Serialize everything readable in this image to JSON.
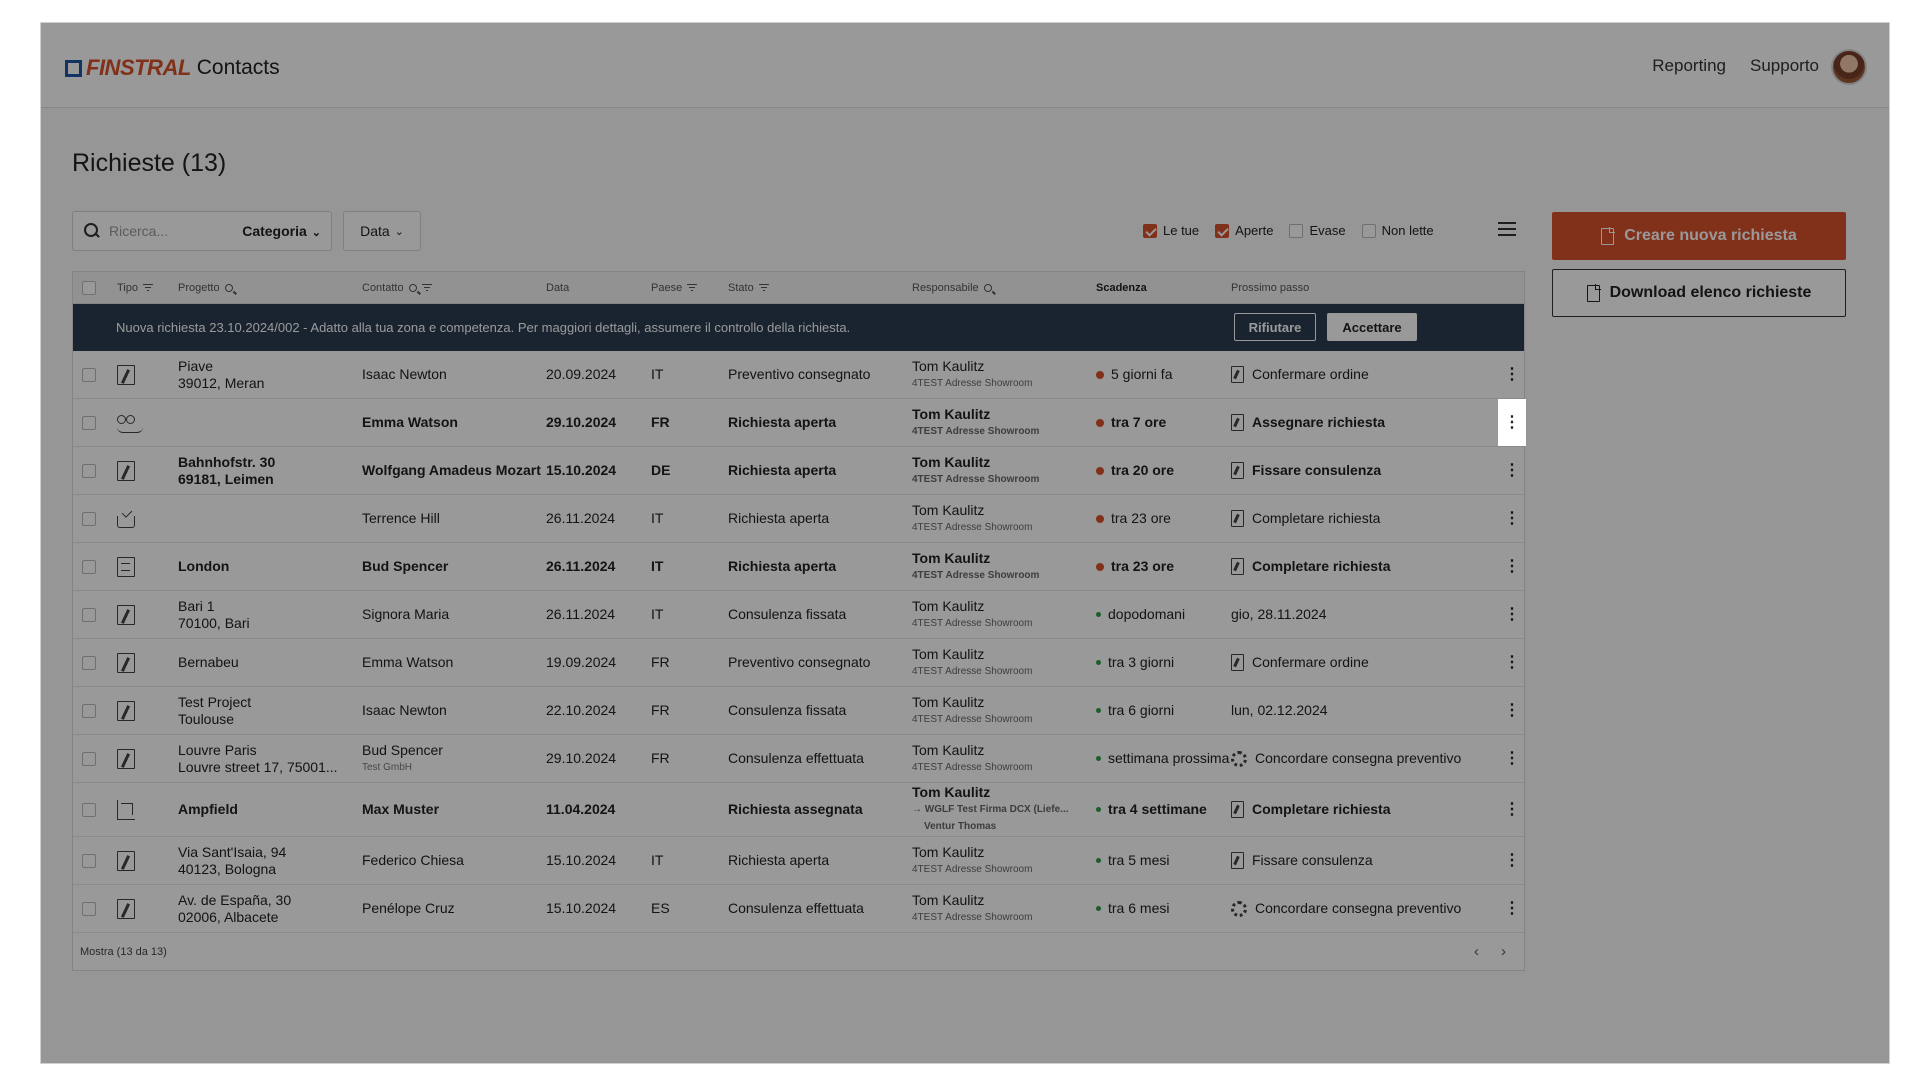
{
  "header": {
    "brand": "FINSTRAL",
    "app_name": "Contacts",
    "nav": [
      "Reporting",
      "Supporto"
    ]
  },
  "page_title": "Richieste (13)",
  "toolbar": {
    "search_placeholder": "Ricerca...",
    "category_label": "Categoria",
    "date_label": "Data",
    "filters": [
      {
        "label": "Le tue",
        "checked": true
      },
      {
        "label": "Aperte",
        "checked": true
      },
      {
        "label": "Evase",
        "checked": false
      },
      {
        "label": "Non lette",
        "checked": false
      }
    ]
  },
  "actions": {
    "create": "Creare nuova richiesta",
    "download": "Download elenco richieste"
  },
  "columns": {
    "tipo": "Tipo",
    "progetto": "Progetto",
    "contatto": "Contatto",
    "data": "Data",
    "paese": "Paese",
    "stato": "Stato",
    "responsabile": "Responsabile",
    "scadenza": "Scadenza",
    "prossimo": "Prossimo passo"
  },
  "banner": {
    "text": "Nuova richiesta 23.10.2024/002 - Adatto alla tua zona e competenza. Per maggiori dettagli, assumere il controllo della richiesta.",
    "reject": "Rifiutare",
    "accept": "Accettare"
  },
  "rows": [
    {
      "type_icon": "project-icon",
      "proj1": "Piave",
      "proj2": "39012, Meran",
      "contact": "Isaac Newton",
      "contact_sub": "",
      "date": "20.09.2024",
      "paese": "IT",
      "stato": "Preventivo consegnato",
      "resp_name": "Tom Kaulitz",
      "resp_sub": "4TEST Adresse Showroom",
      "resp_sub2": "",
      "scad": "5 giorni fa",
      "scad_color": "orange",
      "next_icon": "doc",
      "next": "Confermare ordine",
      "bold": false
    },
    {
      "type_icon": "people-icon",
      "proj1": "",
      "proj2": "",
      "contact": "Emma Watson",
      "contact_sub": "",
      "date": "29.10.2024",
      "paese": "FR",
      "stato": "Richiesta aperta",
      "resp_name": "Tom Kaulitz",
      "resp_sub": "4TEST Adresse Showroom",
      "resp_sub2": "",
      "scad": "tra 7 ore",
      "scad_color": "orange",
      "next_icon": "doc",
      "next": "Assegnare richiesta",
      "bold": true
    },
    {
      "type_icon": "project-icon",
      "proj1": "Bahnhofstr. 30",
      "proj2": "69181, Leimen",
      "contact": "Wolfgang Amadeus Mozart",
      "contact_sub": "",
      "date": "15.10.2024",
      "paese": "DE",
      "stato": "Richiesta aperta",
      "resp_name": "Tom Kaulitz",
      "resp_sub": "4TEST Adresse Showroom",
      "resp_sub2": "",
      "scad": "tra 20 ore",
      "scad_color": "orange",
      "next_icon": "doc",
      "next": "Fissare consulenza",
      "bold": true
    },
    {
      "type_icon": "inbox-icon",
      "proj1": "",
      "proj2": "",
      "contact": "Terrence Hill",
      "contact_sub": "",
      "date": "26.11.2024",
      "paese": "IT",
      "stato": "Richiesta aperta",
      "resp_name": "Tom Kaulitz",
      "resp_sub": "4TEST Adresse Showroom",
      "resp_sub2": "",
      "scad": "tra 23 ore",
      "scad_color": "orange",
      "next_icon": "doc",
      "next": "Completare richiesta",
      "bold": false
    },
    {
      "type_icon": "catalog-icon",
      "proj1": "London",
      "proj2": "",
      "contact": "Bud Spencer",
      "contact_sub": "",
      "date": "26.11.2024",
      "paese": "IT",
      "stato": "Richiesta aperta",
      "resp_name": "Tom Kaulitz",
      "resp_sub": "4TEST Adresse Showroom",
      "resp_sub2": "",
      "scad": "tra 23 ore",
      "scad_color": "orange",
      "next_icon": "doc",
      "next": "Completare richiesta",
      "bold": true
    },
    {
      "type_icon": "project-icon",
      "proj1": "Bari 1",
      "proj2": "70100, Bari",
      "contact": "Signora Maria",
      "contact_sub": "",
      "date": "26.11.2024",
      "paese": "IT",
      "stato": "Consulenza fissata",
      "resp_name": "Tom Kaulitz",
      "resp_sub": "4TEST Adresse Showroom",
      "resp_sub2": "",
      "scad": "dopodomani",
      "scad_color": "green",
      "next_icon": "",
      "next": "gio, 28.11.2024",
      "bold": false
    },
    {
      "type_icon": "project-icon",
      "proj1": "Bernabeu",
      "proj2": "",
      "contact": "Emma Watson",
      "contact_sub": "",
      "date": "19.09.2024",
      "paese": "FR",
      "stato": "Preventivo consegnato",
      "resp_name": "Tom Kaulitz",
      "resp_sub": "4TEST Adresse Showroom",
      "resp_sub2": "",
      "scad": "tra 3 giorni",
      "scad_color": "green",
      "next_icon": "doc",
      "next": "Confermare ordine",
      "bold": false
    },
    {
      "type_icon": "project-icon",
      "proj1": "Test Project",
      "proj2": "Toulouse",
      "contact": "Isaac Newton",
      "contact_sub": "",
      "date": "22.10.2024",
      "paese": "FR",
      "stato": "Consulenza fissata",
      "resp_name": "Tom Kaulitz",
      "resp_sub": "4TEST Adresse Showroom",
      "resp_sub2": "",
      "scad": "tra 6 giorni",
      "scad_color": "green",
      "next_icon": "",
      "next": "lun, 02.12.2024",
      "bold": false
    },
    {
      "type_icon": "project-icon",
      "proj1": "Louvre Paris",
      "proj2": "Louvre street 17, 75001...",
      "contact": "Bud Spencer",
      "contact_sub": "Test GmbH",
      "date": "29.10.2024",
      "paese": "FR",
      "stato": "Consulenza effettuata",
      "resp_name": "Tom Kaulitz",
      "resp_sub": "4TEST Adresse Showroom",
      "resp_sub2": "",
      "scad": "settimana prossima",
      "scad_color": "green",
      "next_icon": "gear",
      "next": "Concordare consegna preventivo",
      "bold": false
    },
    {
      "type_icon": "plan-icon",
      "proj1": "Ampfield",
      "proj2": "",
      "contact": "Max Muster",
      "contact_sub": "",
      "date": "11.04.2024",
      "paese": "",
      "stato": "Richiesta assegnata",
      "resp_name": "Tom Kaulitz",
      "resp_sub": "→ WGLF Test Firma DCX (Liefe...",
      "resp_sub2": "Ventur Thomas",
      "scad": "tra 4 settimane",
      "scad_color": "green",
      "next_icon": "doc",
      "next": "Completare richiesta",
      "bold": true
    },
    {
      "type_icon": "project-icon",
      "proj1": "Via Sant'Isaia, 94",
      "proj2": "40123, Bologna",
      "contact": "Federico Chiesa",
      "contact_sub": "",
      "date": "15.10.2024",
      "paese": "IT",
      "stato": "Richiesta aperta",
      "resp_name": "Tom Kaulitz",
      "resp_sub": "4TEST Adresse Showroom",
      "resp_sub2": "",
      "scad": "tra 5 mesi",
      "scad_color": "green",
      "next_icon": "doc",
      "next": "Fissare consulenza",
      "bold": false
    },
    {
      "type_icon": "project-icon",
      "proj1": "Av. de España, 30",
      "proj2": "02006, Albacete",
      "contact": "Penélope Cruz",
      "contact_sub": "",
      "date": "15.10.2024",
      "paese": "ES",
      "stato": "Consulenza effettuata",
      "resp_name": "Tom Kaulitz",
      "resp_sub": "4TEST Adresse Showroom",
      "resp_sub2": "",
      "scad": "tra 6 mesi",
      "scad_color": "green",
      "next_icon": "gear",
      "next": "Concordare consegna preventivo",
      "bold": false
    }
  ],
  "more_glyph": "⋮",
  "footer": {
    "text": "Mostra  (13 da 13)",
    "prev": "‹",
    "next": "›"
  }
}
